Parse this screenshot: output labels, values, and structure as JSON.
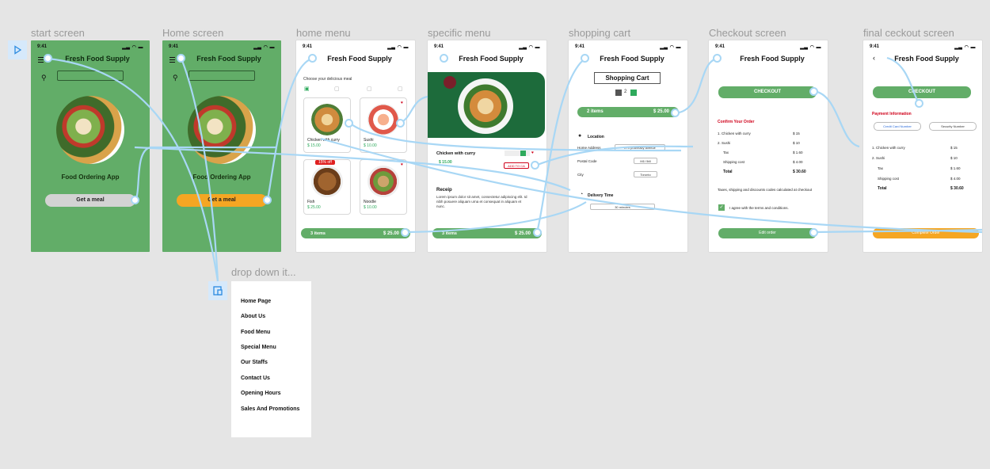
{
  "frames": {
    "start": {
      "label": "start screen",
      "time": "9:41",
      "title": "Fresh Food Supply",
      "app_title": "Food Ordering App",
      "cta": "Get a meal"
    },
    "home": {
      "label": "Home screen",
      "time": "9:41",
      "title": "Fresh Food Supply",
      "app_title": "Food Ordering App",
      "cta": "Get a meal"
    },
    "home_menu": {
      "label": "home menu",
      "time": "9:41",
      "title": "Fresh Food Supply",
      "subtitle": "Choose your delicious meal",
      "cards": [
        {
          "name": "Chicken with curry",
          "price": "$ 15.00"
        },
        {
          "name": "Sushi",
          "price": "$ 10.00"
        },
        {
          "name": "Fish",
          "price": "$ 25.00",
          "badge": "15% off"
        },
        {
          "name": "Noodle",
          "price": "$ 10.00"
        }
      ],
      "bar_items": "3 items",
      "bar_price": "$ 25.00"
    },
    "specific_menu": {
      "label": "specific menu",
      "time": "9:41",
      "title": "Fresh Food Supply",
      "item_name": "Chicken with curry",
      "item_price": "$ 15.00",
      "add_to_cart": "ADD TO CA",
      "recipe_heading": "Receip",
      "recipe_text": "Lorem ipsum dolor sit amet, consectetur adipiscing elit. Id nibh posuere aliquam urna et consequat in aliquam et nunc.",
      "bar_items": "3 items",
      "bar_price": "$ 25.00"
    },
    "cart": {
      "label": "shopping cart",
      "time": "9:41",
      "title": "Fresh Food Supply",
      "heading": "Shopping Cart",
      "qty": "2",
      "bar_items": "2 items",
      "bar_price": "$ 25.00",
      "location": "Location",
      "home_address_label": "Home Address",
      "home_address": "273 pharmacy avenue",
      "postal_label": "Postal Code",
      "postal": "M1I 5t8",
      "city_label": "City",
      "city": "Toronto",
      "delivery_label": "Delivery Time",
      "delivery": "30 minutes"
    },
    "checkout": {
      "label": "Checkout screen",
      "time": "9:41",
      "title": "Fresh Food Supply",
      "button": "CHECKOUT",
      "confirm_heading": "Confirm Your Order",
      "lines": [
        {
          "item": "1. Chicken with curry",
          "price": "$ 15"
        },
        {
          "item": "2. Sushi",
          "price": "$ 10"
        },
        {
          "item": "Tax",
          "price": "$ 1.60"
        },
        {
          "item": "Shipping cost",
          "price": "$ 4.00"
        },
        {
          "item": "Total",
          "price": "$ 30.60"
        }
      ],
      "notice": "Taxes, shipping and discounts codes calculated at checkout",
      "agree": "I agree with the terms and conditions.",
      "edit_order": "Edit order"
    },
    "final": {
      "label": "final ceckout screen",
      "time": "9:41",
      "title": "Fresh Food Supply",
      "button": "CHECKOUT",
      "payment_heading": "Payment Information",
      "card_field": "Credit Card Number",
      "security_field": "Security Number",
      "lines": [
        {
          "item": "1. Chicken with curry",
          "price": "$ 15"
        },
        {
          "item": "2. Sushi",
          "price": "$ 10"
        },
        {
          "item": "Tax",
          "price": "$ 1.60"
        },
        {
          "item": "Shipping cost",
          "price": "$ 4.00"
        },
        {
          "item": "Total",
          "price": "$ 30.60"
        }
      ],
      "complete": "Complete Order"
    }
  },
  "dropdown": {
    "label": "drop down it...",
    "items": [
      "Home Page",
      "About Us",
      "Food Menu",
      "Special Menu",
      "Our Staffs",
      "Contact Us",
      "Opening Hours",
      "Sales And Promotions"
    ]
  },
  "colors": {
    "canvas": "#e5e5e5",
    "green": "#62ad68",
    "orange": "#f5a623",
    "wire": "#a8d7f5",
    "red": "#d0021b",
    "play_bg": "#d6e9fb"
  },
  "icons": {
    "play": "play-icon",
    "device": "device-icon"
  }
}
